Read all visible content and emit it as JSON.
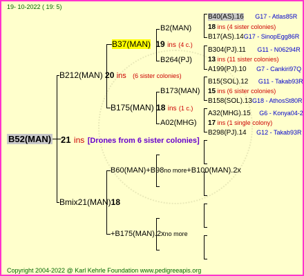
{
  "header": {
    "date": "19-  10-2022  ( 19:  5)"
  },
  "footer": {
    "copyright": "Copyright 2004-2022 @ Karl Kehrle Foundation    www.pedigreeapis.org"
  },
  "root": {
    "label": "B52(MAN)",
    "count": "21",
    "ins": "ins",
    "note": "[Drones from 6 sister colonies]"
  },
  "sire": {
    "label": "B212(MAN)",
    "count": "20",
    "ins": "ins",
    "note": "(6 sister colonies)"
  },
  "dam": {
    "label": "Bmix21(MAN)",
    "count": "18"
  },
  "s1": {
    "label": "B37(MAN)",
    "count": "19",
    "ins": "ins",
    "note": "(4 c.)"
  },
  "s2": {
    "label": "B175(MAN)",
    "count": "18",
    "ins": "ins",
    "note": "(1 c.)"
  },
  "d1": {
    "label": "B60(MAN)+B98",
    "more": "no more",
    "tail": "+B100(MAN).2x"
  },
  "d2": {
    "label": "+B175(MAN).2x",
    "more": "no more"
  },
  "g1": {
    "label": "B2(MAN)"
  },
  "g2": {
    "label": "B264(PJ)"
  },
  "g3": {
    "label": "B173(MAN)"
  },
  "g4": {
    "label": "A02(MHG)"
  },
  "r1": {
    "label": "B40(AS).16",
    "code": "G17 - Atlas85R"
  },
  "r1c": {
    "count": "18",
    "ins": "ins",
    "note": "(4 sister colonies)"
  },
  "r2": {
    "label": "B17(AS).14",
    "code": "G17 - SinopEgg86R"
  },
  "r3": {
    "label": "B304(PJ).11",
    "code": "G11 - N06294R"
  },
  "r3c": {
    "count": "13",
    "ins": "ins",
    "note": "(11 sister colonies)"
  },
  "r4": {
    "label": "A199(PJ).10",
    "code": "G7 - Cankiri97Q"
  },
  "r5": {
    "label": "B15(SOL).12",
    "code": "G11 - Takab93R"
  },
  "r5c": {
    "count": "15",
    "ins": "ins",
    "note": "(6 sister colonies)"
  },
  "r6": {
    "label": "B158(SOL).13",
    "code": "G18 - AthosSt80R"
  },
  "r7": {
    "label": "A32(MHG).15",
    "code": "G6 - Konya04-2"
  },
  "r7c": {
    "count": "17",
    "ins": "ins",
    "note": "(1 single colony)"
  },
  "r8": {
    "label": "B298(PJ).14",
    "code": "G12 - Takab93R"
  }
}
